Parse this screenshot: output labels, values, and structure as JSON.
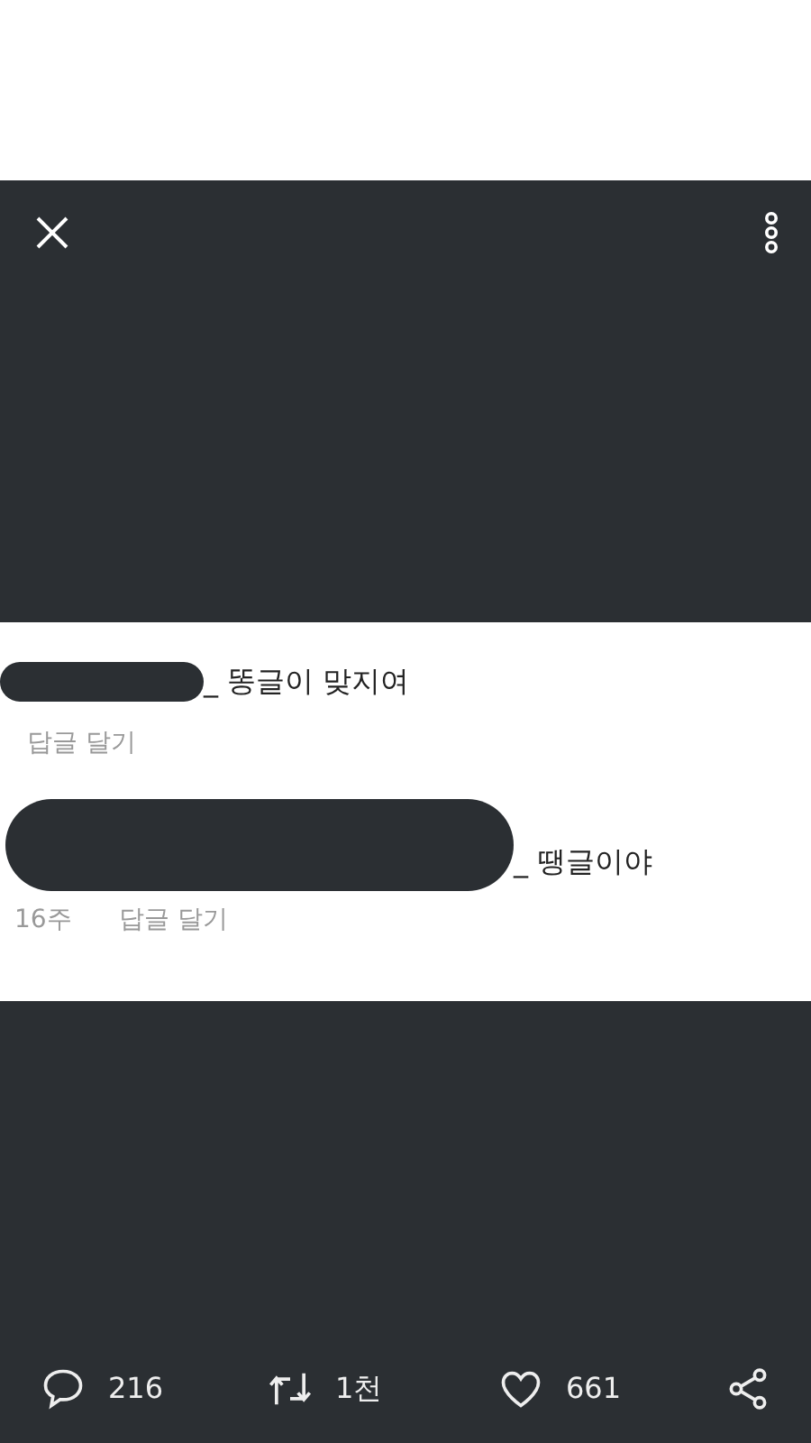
{
  "comments": [
    {
      "kind": "short",
      "text": "_ 똥글이 맞지여",
      "reply": "답글 달기"
    },
    {
      "kind": "long",
      "text": "_ 땡글이야",
      "time": "16주",
      "reply": "답글 달기"
    }
  ],
  "actions": [
    {
      "kind": "comment",
      "count": "216"
    },
    {
      "kind": "retweet",
      "count": "1천"
    },
    {
      "kind": "like",
      "count": "661"
    },
    {
      "kind": "share"
    }
  ]
}
